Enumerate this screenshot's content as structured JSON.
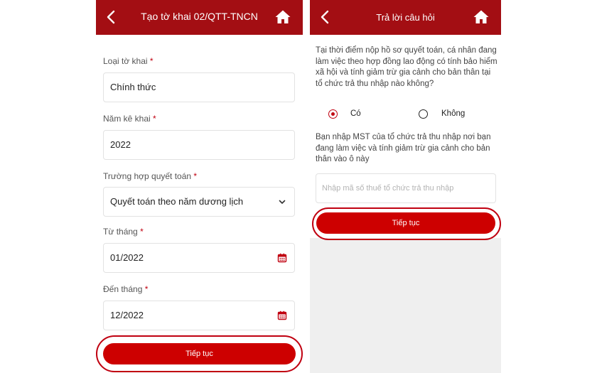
{
  "colors": {
    "header_bg": "#a30e13",
    "primary": "#cd0000",
    "required": "#c00010"
  },
  "left_screen": {
    "title": "Tạo tờ khai 02/QTT-TNCN",
    "fields": [
      {
        "label": "Loại tờ khai",
        "required": "*",
        "value": "Chính thức"
      },
      {
        "label": "Năm kê khai",
        "required": "*",
        "value": "2022"
      },
      {
        "label": "Trường hợp quyết toán",
        "required": "*",
        "value": "Quyết toán theo năm dương lịch",
        "icon": "chevron-down-icon"
      },
      {
        "label": "Từ tháng",
        "required": "*",
        "value": "01/2022",
        "icon": "calendar-icon"
      },
      {
        "label": "Đến tháng",
        "required": "*",
        "value": "12/2022",
        "icon": "calendar-icon"
      }
    ],
    "continue_label": "Tiếp tục"
  },
  "right_screen": {
    "title": "Trả lời câu hỏi",
    "question1": "Tại thời điểm nộp hồ sơ quyết toán, cá nhân đang làm việc theo hợp đồng lao động có tính bảo hiểm xã hội và tính giảm trừ gia cảnh cho bản thân tại tổ chức trả thu nhập nào không?",
    "options": [
      {
        "label": "Có",
        "selected": true
      },
      {
        "label": "Không",
        "selected": false
      }
    ],
    "question2": "Bạn nhập MST của tổ chức trả thu nhập nơi bạn đang làm việc và tính giảm trừ gia cảnh cho bản thân vào ô này",
    "mst_placeholder": "Nhập mã số thuế tổ chức trả thu nhập",
    "continue_label": "Tiếp tục"
  }
}
